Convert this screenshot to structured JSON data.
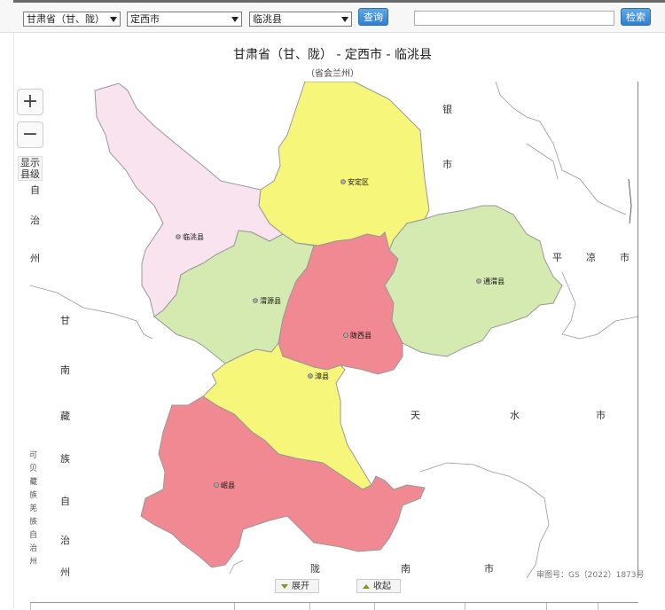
{
  "toolbar": {
    "province": "甘肃省（甘、陇）",
    "city": "定西市",
    "county": "临洮县",
    "query_label": "查询",
    "search_value": "",
    "search_label": "检索"
  },
  "map": {
    "title": "甘肃省（甘、陇） - 定西市 - 临洮县",
    "subtitle": "（省会兰州）",
    "zoom_in": "+",
    "zoom_out": "−",
    "show_county_line1": "显示",
    "show_county_line2": "县级",
    "approval": "审图号：GS（2022）1873号",
    "colors": {
      "pink": "#f9e3ef",
      "yellow": "#f6f67a",
      "red": "#f08991",
      "green": "#d5eab0",
      "border": "#999999"
    },
    "counties": [
      {
        "id": "lintao",
        "name": "临洮县",
        "color": "pink"
      },
      {
        "id": "anding",
        "name": "安定区",
        "color": "yellow"
      },
      {
        "id": "weiyuan",
        "name": "渭源县",
        "color": "green"
      },
      {
        "id": "longxi",
        "name": "陇西县",
        "color": "red"
      },
      {
        "id": "tongwei",
        "name": "通渭县",
        "color": "green"
      },
      {
        "id": "zhangxian",
        "name": "漳县",
        "color": "yellow"
      },
      {
        "id": "minxian",
        "name": "岷县",
        "color": "red"
      }
    ],
    "surrounding": {
      "baiyin": [
        "银",
        "市"
      ],
      "linxia": [
        "自",
        "治",
        "州"
      ],
      "pingliang": [
        "平",
        "凉",
        "市"
      ],
      "gannan": [
        "甘",
        "南",
        "藏",
        "族",
        "自",
        "治",
        "州"
      ],
      "tianshui": [
        "天",
        "水",
        "市"
      ],
      "longnan": [
        "陇",
        "南",
        "市"
      ],
      "edge_text": [
        "可",
        "贝",
        "藏",
        "族",
        "羌",
        "族",
        "自",
        "治",
        "州"
      ]
    }
  },
  "controls": {
    "expand_label": "展开",
    "collapse_label": "收起"
  }
}
